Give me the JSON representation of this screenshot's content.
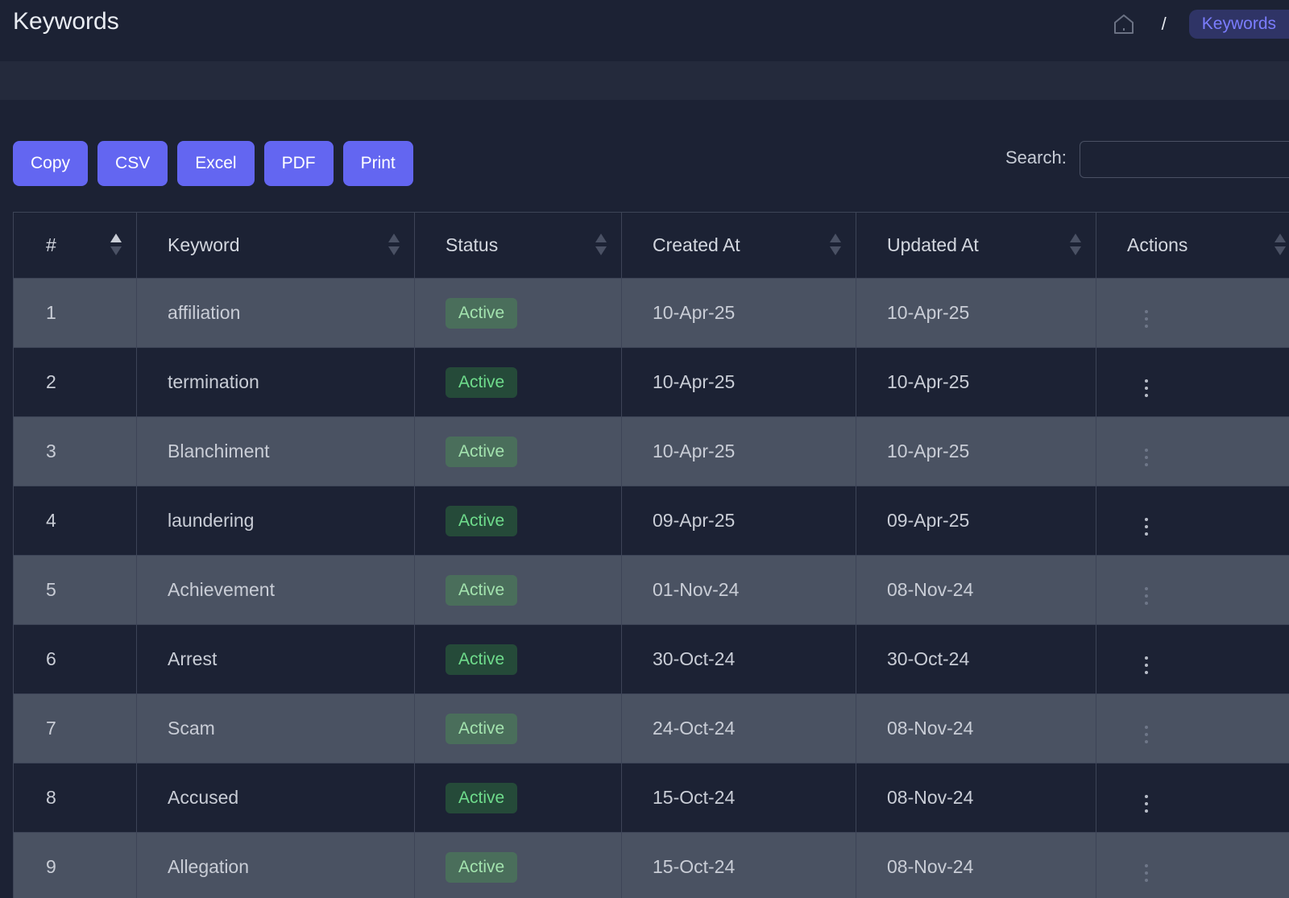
{
  "page": {
    "title": "Keywords"
  },
  "breadcrumb": {
    "home_icon": "home-icon",
    "separator": "/",
    "current": "Keywords"
  },
  "toolbar": {
    "buttons": [
      "Copy",
      "CSV",
      "Excel",
      "PDF",
      "Print"
    ]
  },
  "search": {
    "label": "Search:",
    "value": ""
  },
  "table": {
    "columns": [
      "#",
      "Keyword",
      "Status",
      "Created At",
      "Updated At",
      "Actions"
    ],
    "rows": [
      {
        "num": "1",
        "keyword": "affiliation",
        "status": "Active",
        "created": "10-Apr-25",
        "updated": "10-Apr-25"
      },
      {
        "num": "2",
        "keyword": "termination",
        "status": "Active",
        "created": "10-Apr-25",
        "updated": "10-Apr-25"
      },
      {
        "num": "3",
        "keyword": "Blanchiment",
        "status": "Active",
        "created": "10-Apr-25",
        "updated": "10-Apr-25"
      },
      {
        "num": "4",
        "keyword": "laundering",
        "status": "Active",
        "created": "09-Apr-25",
        "updated": "09-Apr-25"
      },
      {
        "num": "5",
        "keyword": "Achievement",
        "status": "Active",
        "created": "01-Nov-24",
        "updated": "08-Nov-24"
      },
      {
        "num": "6",
        "keyword": "Arrest",
        "status": "Active",
        "created": "30-Oct-24",
        "updated": "30-Oct-24"
      },
      {
        "num": "7",
        "keyword": "Scam",
        "status": "Active",
        "created": "24-Oct-24",
        "updated": "08-Nov-24"
      },
      {
        "num": "8",
        "keyword": "Accused",
        "status": "Active",
        "created": "15-Oct-24",
        "updated": "08-Nov-24"
      },
      {
        "num": "9",
        "keyword": "Allegation",
        "status": "Active",
        "created": "15-Oct-24",
        "updated": "08-Nov-24"
      }
    ],
    "action_icon": "kebab-menu-icon"
  },
  "colors": {
    "background": "#1c2234",
    "accent": "#6366f1",
    "status_active": "#6fdc8c",
    "row_alt": "#4a5262"
  }
}
